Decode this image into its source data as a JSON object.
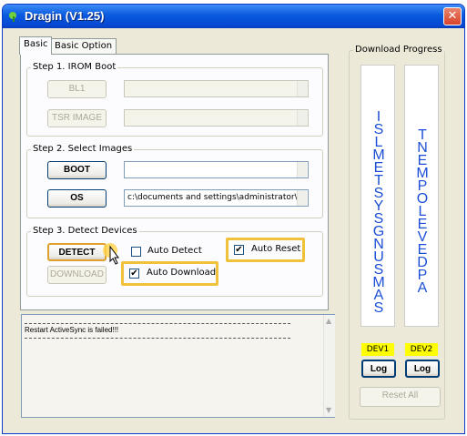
{
  "window": {
    "title": "Dragin (V1.25)"
  },
  "tabs": [
    {
      "label": "Basic",
      "active": true
    },
    {
      "label": "Basic Option",
      "active": false
    }
  ],
  "step1": {
    "legend": "Step 1. IROM Boot",
    "bl1_button": "BL1",
    "bl1_path": "",
    "tsr_button": "TSR IMAGE",
    "tsr_path": ""
  },
  "step2": {
    "legend": "Step 2. Select Images",
    "boot_button": "BOOT",
    "boot_path": "",
    "os_button": "OS",
    "os_path": "c:\\documents and settings\\administrator\\바"
  },
  "step3": {
    "legend": "Step 3. Detect Devices",
    "detect_button": "DETECT",
    "download_button": "DOWNLOAD",
    "auto_detect": {
      "label": "Auto Detect",
      "checked": false
    },
    "auto_reset": {
      "label": "Auto Reset",
      "checked": true
    },
    "auto_download": {
      "label": "Auto Download",
      "checked": true
    }
  },
  "log": {
    "lines": [
      "Restart ActiveSync is failed!!!"
    ]
  },
  "download_progress": {
    "legend": "Download Progress",
    "dev1": {
      "text": [
        "I",
        "S",
        "L",
        "M",
        "E",
        "T",
        "S",
        "Y",
        "S",
        "G",
        "N",
        "U",
        "S",
        "M",
        "A",
        "S"
      ],
      "label": "DEV1",
      "log_button": "Log"
    },
    "dev2": {
      "text": [
        "T",
        "N",
        "E",
        "M",
        "P",
        "O",
        "L",
        "E",
        "V",
        "E",
        "D",
        "P",
        "A"
      ],
      "label": "DEV2",
      "log_button": "Log"
    },
    "reset_all_button": "Reset All"
  },
  "checkmark_glyph": "✔",
  "colors": {
    "title_bar": "#0a5ae0",
    "highlight": "#f0c23c",
    "device_label": "#ffff00",
    "vertical_text": "#1c4fd6"
  }
}
